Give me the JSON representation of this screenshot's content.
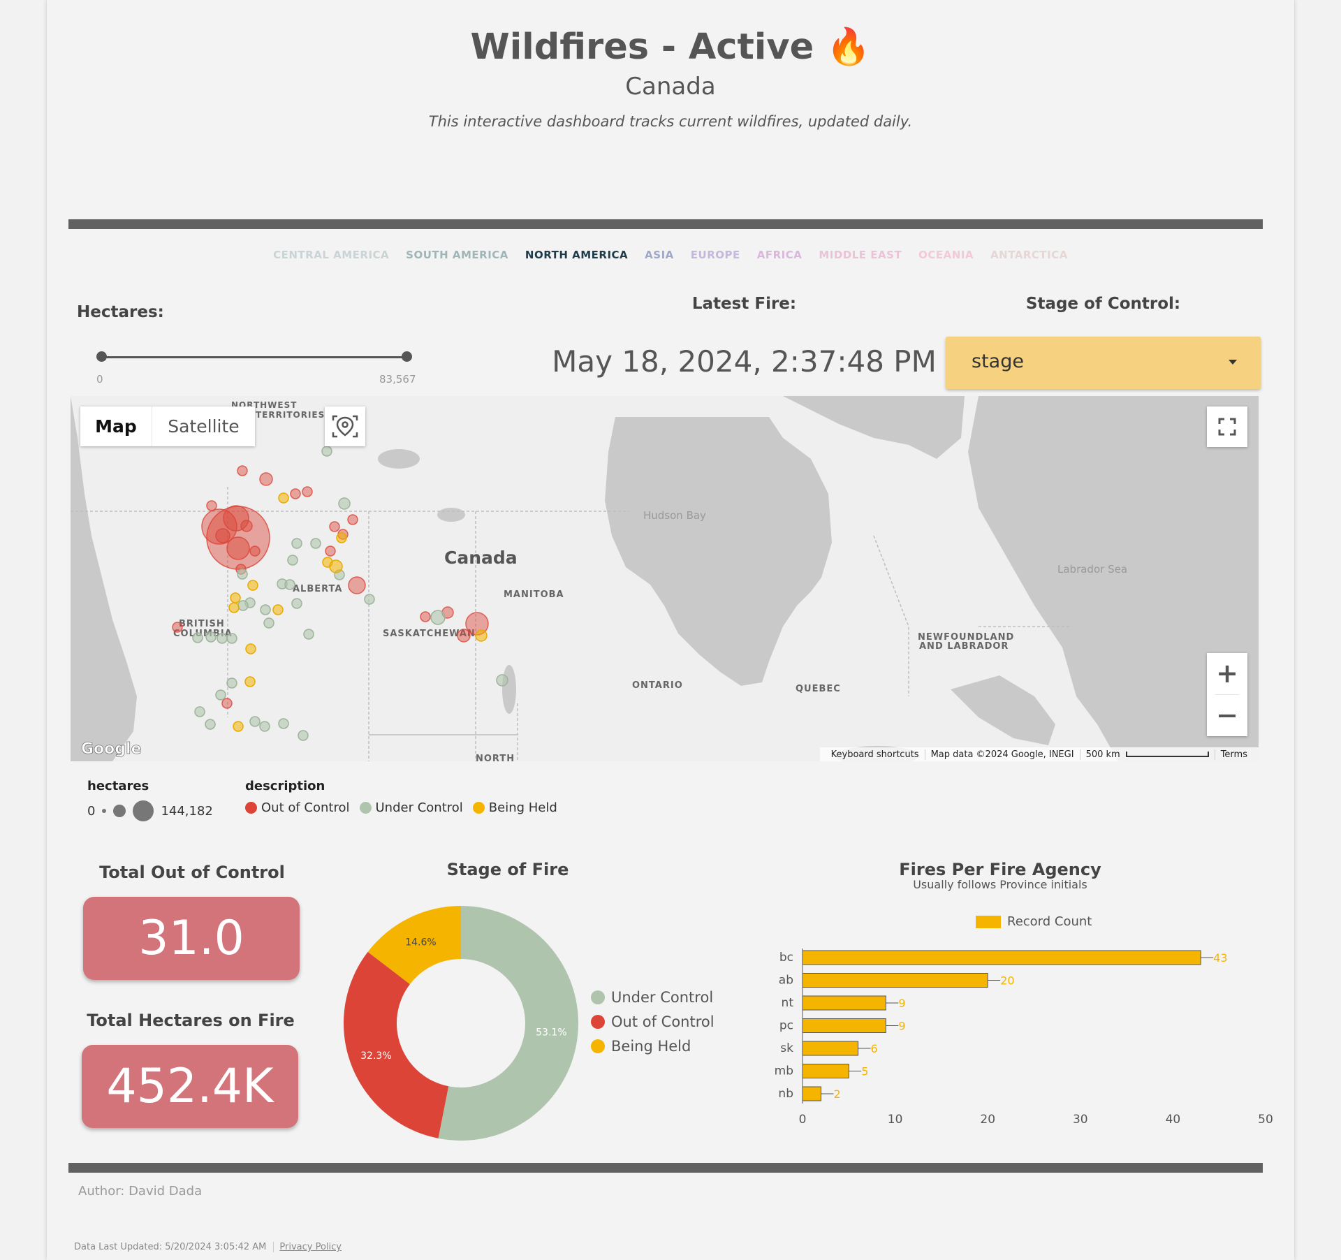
{
  "header": {
    "title": "Wildfires - Active 🔥",
    "subtitle": "Canada",
    "intro": "This interactive dashboard tracks current wildfires, updated daily."
  },
  "regions": [
    {
      "label": "CENTRAL AMERICA",
      "color": "#c9d4d4"
    },
    {
      "label": "SOUTH AMERICA",
      "color": "#9fb6b8"
    },
    {
      "label": "NORTH AMERICA",
      "color": "#1e3b4a"
    },
    {
      "label": "ASIA",
      "color": "#9fa8c8"
    },
    {
      "label": "EUROPE",
      "color": "#c5b8dc"
    },
    {
      "label": "AFRICA",
      "color": "#d9b8dc"
    },
    {
      "label": "MIDDLE EAST",
      "color": "#ebc3d6"
    },
    {
      "label": "OCEANIA",
      "color": "#f3c8d8"
    },
    {
      "label": "ANTARCTICA",
      "color": "#e6d6d6"
    }
  ],
  "filters": {
    "hectares_label": "Hectares:",
    "hectares_min": "0",
    "hectares_max": "83,567",
    "latest_label": "Latest Fire:",
    "latest_value": "May 18, 2024, 2:37:48 PM",
    "stage_label": "Stage of Control:",
    "stage_value": "stage"
  },
  "map": {
    "tab_map": "Map",
    "tab_satellite": "Satellite",
    "country": "Canada",
    "places": {
      "northwest": "NORTHWEST",
      "territories": "TERRITORIES",
      "hudson_bay": "Hudson Bay",
      "labrador_sea": "Labrador Sea",
      "alberta": "ALBERTA",
      "manitoba": "MANITOBA",
      "british": "BRITISH",
      "columbia": "COLUMBIA",
      "saskatchewan": "SASKATCHEWAN",
      "nfld1": "NEWFOUNDLAND",
      "nfld2": "AND LABRADOR",
      "ontario": "ONTARIO",
      "quebec": "QUEBEC",
      "north": "NORTH"
    },
    "google": "Google",
    "keyboard_shortcuts": "Keyboard shortcuts",
    "map_data": "Map data ©2024 Google, INEGI",
    "scale": "500 km",
    "terms": "Terms"
  },
  "legend": {
    "size_title": "hectares",
    "size_min": "0",
    "size_max": "144,182",
    "color_title": "description",
    "items": [
      {
        "label": "Out of Control",
        "color": "#db4437"
      },
      {
        "label": "Under Control",
        "color": "#afc4ad"
      },
      {
        "label": "Being Held",
        "color": "#f4b400"
      }
    ]
  },
  "scorecards": {
    "out_of_control_label": "Total Out of Control",
    "out_of_control_value": "31.0",
    "hectares_label": "Total Hectares on Fire",
    "hectares_value": "452.4K"
  },
  "donut": {
    "title": "Stage of Fire",
    "legend": [
      "Under Control",
      "Out of Control",
      "Being Held"
    ]
  },
  "bar": {
    "title": "Fires Per Fire Agency",
    "subtitle": "Usually follows Province initials",
    "legend": "Record Count"
  },
  "chart_data": [
    {
      "type": "pie",
      "title": "Stage of Fire",
      "categories": [
        "Under Control",
        "Out of Control",
        "Being Held"
      ],
      "values": [
        53.1,
        32.3,
        14.6
      ],
      "colors": [
        "#afc4ad",
        "#db4437",
        "#f4b400"
      ],
      "donut": true,
      "legend_position": "right"
    },
    {
      "type": "bar",
      "orientation": "horizontal",
      "title": "Fires Per Fire Agency",
      "subtitle": "Usually follows Province initials",
      "categories": [
        "bc",
        "ab",
        "nt",
        "pc",
        "sk",
        "mb",
        "nb"
      ],
      "series": [
        {
          "name": "Record Count",
          "values": [
            43,
            20,
            9,
            9,
            6,
            5,
            2
          ],
          "color": "#f4b400"
        }
      ],
      "xlim": [
        0,
        50
      ],
      "xticks": [
        "0",
        "10",
        "20",
        "30",
        "40",
        "50"
      ],
      "legend_position": "top",
      "grid": false
    }
  ],
  "footer": {
    "author": "Author: David Dada",
    "updated": "Data Last Updated: 5/20/2024 3:05:42 AM",
    "privacy": "Privacy Policy"
  }
}
